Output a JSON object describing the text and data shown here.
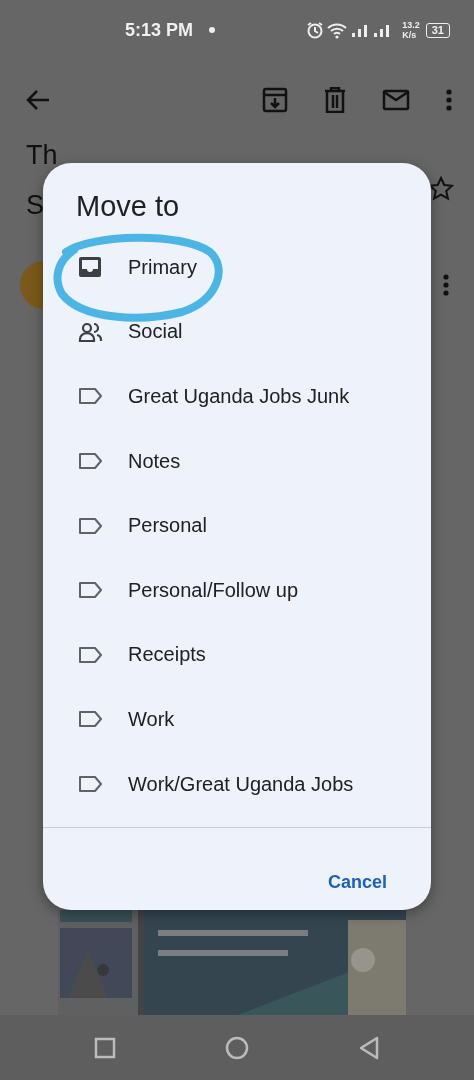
{
  "status_bar": {
    "time": "5:13 PM",
    "net_speed_value": "13.2",
    "net_speed_unit": "K/s",
    "battery": "31"
  },
  "email": {
    "subject_fragments": [
      "Th",
      "S"
    ]
  },
  "dialog": {
    "title": "Move to",
    "items": [
      {
        "label": "Primary",
        "kind": "inbox"
      },
      {
        "label": "Social",
        "kind": "people"
      },
      {
        "label": "Great Uganda Jobs Junk",
        "kind": "label"
      },
      {
        "label": "Notes",
        "kind": "label"
      },
      {
        "label": "Personal",
        "kind": "label"
      },
      {
        "label": "Personal/Follow up",
        "kind": "label"
      },
      {
        "label": "Receipts",
        "kind": "label"
      },
      {
        "label": "Work",
        "kind": "label"
      },
      {
        "label": "Work/Great Uganda Jobs",
        "kind": "label"
      }
    ],
    "cancel": "Cancel"
  }
}
